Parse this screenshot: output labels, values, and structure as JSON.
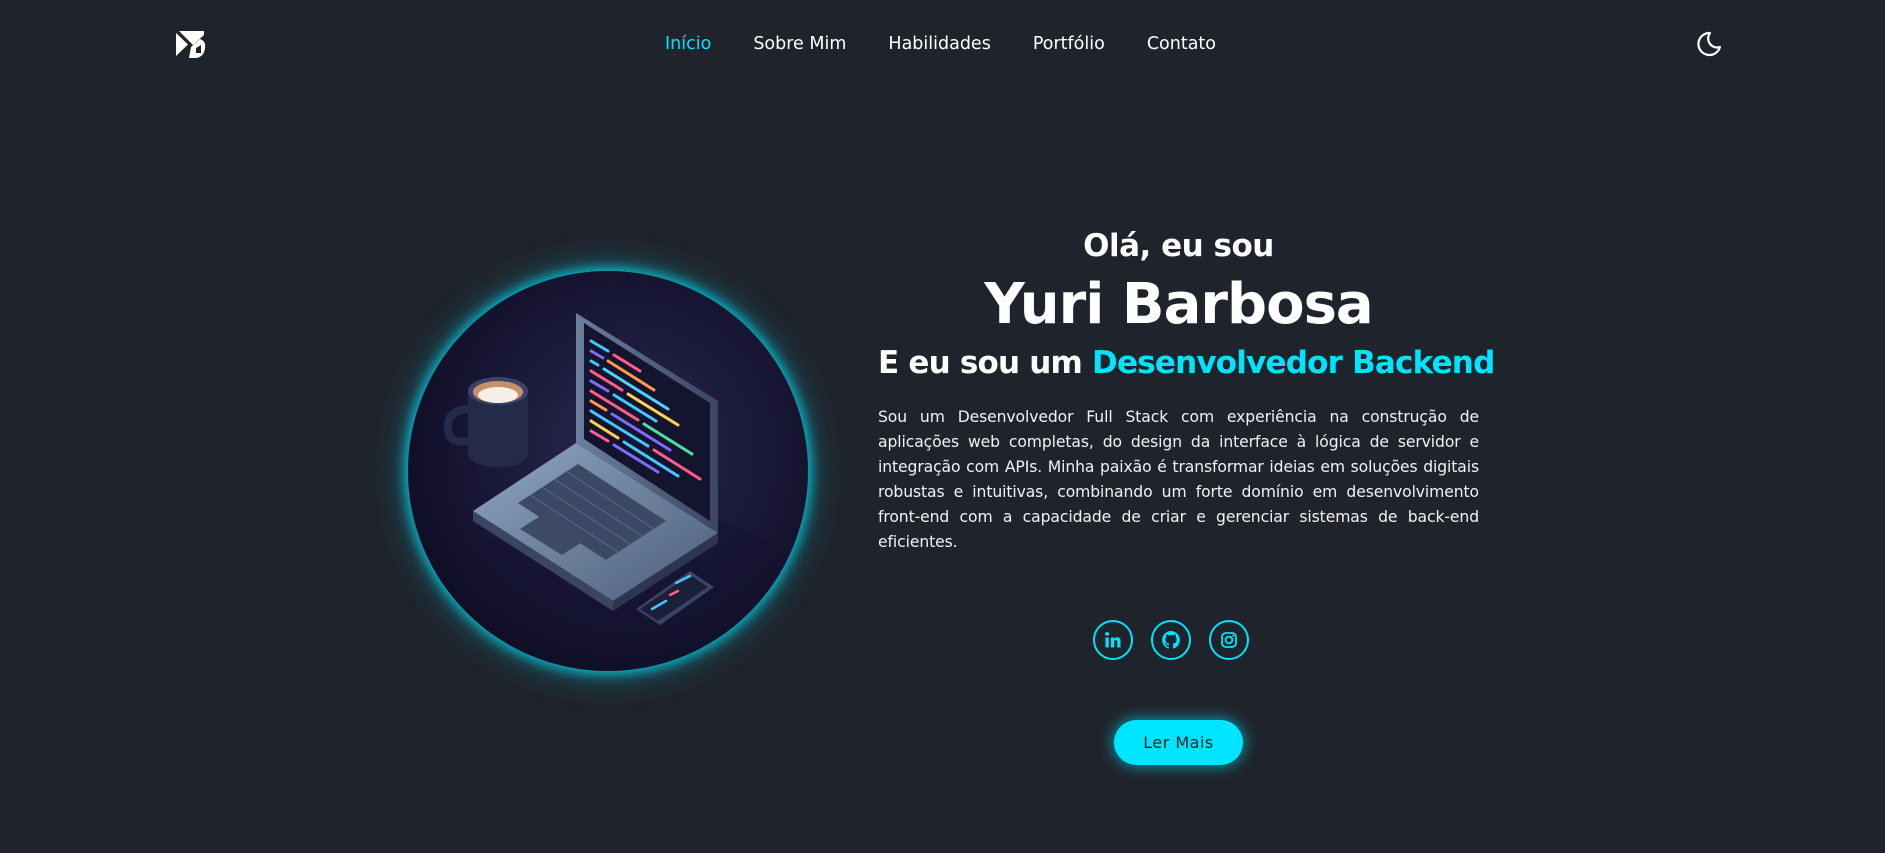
{
  "header": {
    "logo_icon": "yb-logo-icon",
    "nav": [
      {
        "label": "Início",
        "active": true
      },
      {
        "label": "Sobre Mim",
        "active": false
      },
      {
        "label": "Habilidades",
        "active": false
      },
      {
        "label": "Portfólio",
        "active": false
      },
      {
        "label": "Contato",
        "active": false
      }
    ],
    "theme_toggle_icon": "moon-icon"
  },
  "hero": {
    "image_icon": "laptop-coffee-illustration",
    "greeting": "Olá, eu sou",
    "name": "Yuri Barbosa",
    "role_prefix": "E eu sou um ",
    "role_highlight": "Desenvolvedor Backend",
    "bio": "Sou um Desenvolvedor Full Stack com experiência na construção de aplicações web completas, do design da interface à lógica de servidor e integração com APIs. Minha paixão é transformar ideias em soluções digitais robustas e intuitivas, combinando um forte domínio em desenvolvimento front-end com a capacidade de criar e gerenciar sistemas de back-end eficientes."
  },
  "social": [
    {
      "icon": "linkedin-icon"
    },
    {
      "icon": "github-icon"
    },
    {
      "icon": "instagram-icon"
    }
  ],
  "cta": {
    "label": "Ler Mais"
  },
  "colors": {
    "background": "#1f232b",
    "accent": "#00e5ff",
    "text": "#ffffff"
  }
}
